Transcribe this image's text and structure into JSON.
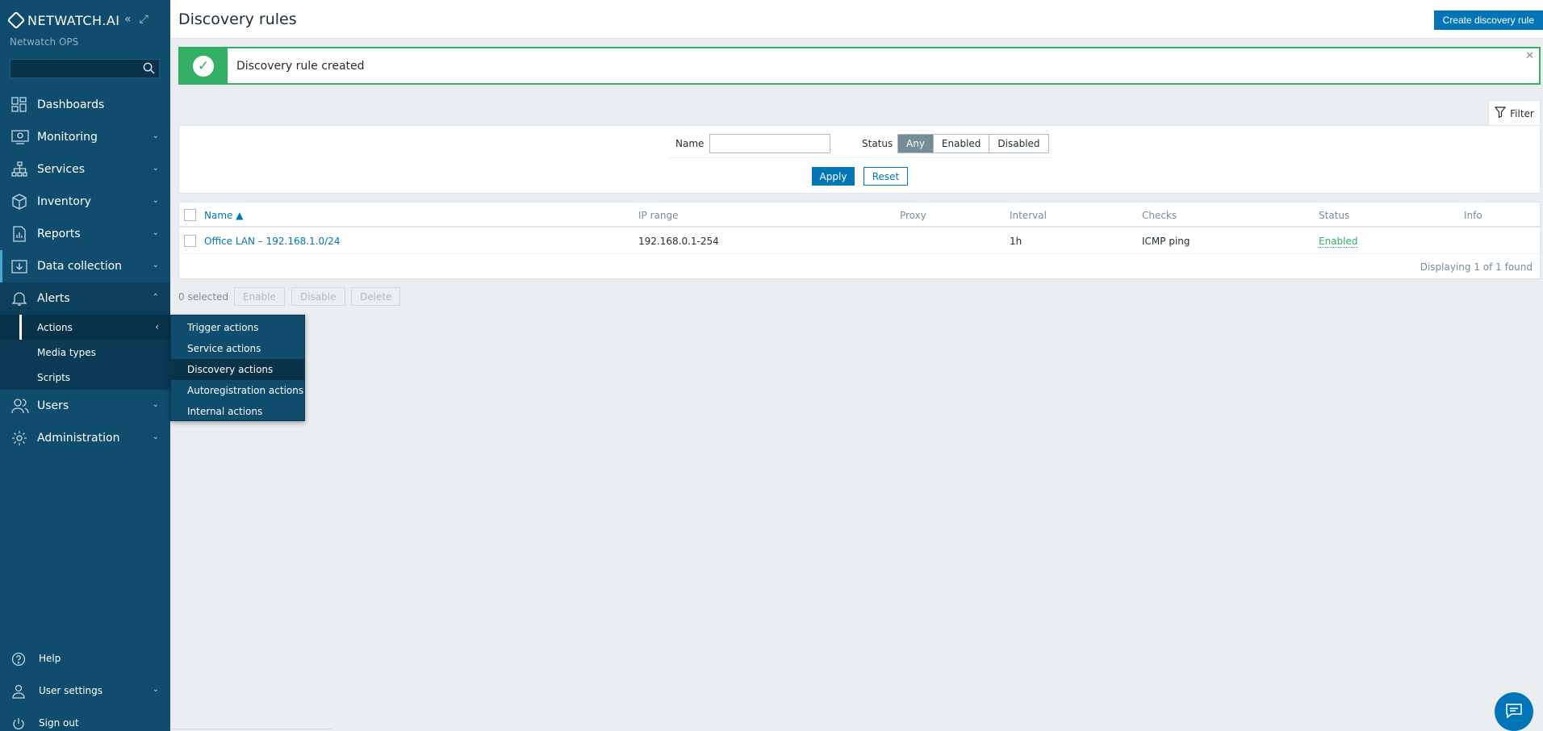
{
  "app": {
    "logo_text": "NETWATCH.AI",
    "org_name": "Netwatch OPS"
  },
  "search": {
    "placeholder": ""
  },
  "sidebar": {
    "items": [
      {
        "label": "Dashboards",
        "icon": "dashboards-icon"
      },
      {
        "label": "Monitoring",
        "icon": "monitoring-icon"
      },
      {
        "label": "Services",
        "icon": "services-icon"
      },
      {
        "label": "Inventory",
        "icon": "inventory-icon"
      },
      {
        "label": "Reports",
        "icon": "reports-icon"
      },
      {
        "label": "Data collection",
        "icon": "data-collection-icon"
      },
      {
        "label": "Alerts",
        "icon": "bell-icon"
      },
      {
        "label": "Users",
        "icon": "users-icon"
      },
      {
        "label": "Administration",
        "icon": "gear-icon"
      }
    ],
    "alerts_sub": [
      {
        "label": "Actions"
      },
      {
        "label": "Media types"
      },
      {
        "label": "Scripts"
      }
    ],
    "bottom": [
      {
        "label": "Help",
        "icon": "help-icon"
      },
      {
        "label": "User settings",
        "icon": "user-icon"
      },
      {
        "label": "Sign out",
        "icon": "power-icon"
      }
    ]
  },
  "flyout": {
    "items": [
      {
        "label": "Trigger actions"
      },
      {
        "label": "Service actions"
      },
      {
        "label": "Discovery actions"
      },
      {
        "label": "Autoregistration actions"
      },
      {
        "label": "Internal actions"
      }
    ]
  },
  "header": {
    "title": "Discovery rules",
    "create_button": "Create discovery rule"
  },
  "message": {
    "text": "Discovery rule created"
  },
  "filter": {
    "tab_label": "Filter",
    "name_label": "Name",
    "name_value": "",
    "status_label": "Status",
    "status_options": [
      "Any",
      "Enabled",
      "Disabled"
    ],
    "status_selected": "Any",
    "apply": "Apply",
    "reset": "Reset"
  },
  "table": {
    "columns": [
      "Name",
      "IP range",
      "Proxy",
      "Interval",
      "Checks",
      "Status",
      "Info"
    ],
    "sort_column": "Name",
    "sort_dir": "asc",
    "rows": [
      {
        "name": "Office LAN – 192.168.1.0/24",
        "ip_range": "192.168.0.1-254",
        "proxy": "",
        "interval": "1h",
        "checks": "ICMP ping",
        "status": "Enabled",
        "info": ""
      }
    ],
    "footer": "Displaying 1 of 1 found"
  },
  "actions_bar": {
    "selected": "0 selected",
    "enable": "Enable",
    "disable": "Disable",
    "delete": "Delete"
  },
  "colors": {
    "sidebar": "#0f4c6e",
    "primary": "#0275b8",
    "success": "#34af67"
  }
}
